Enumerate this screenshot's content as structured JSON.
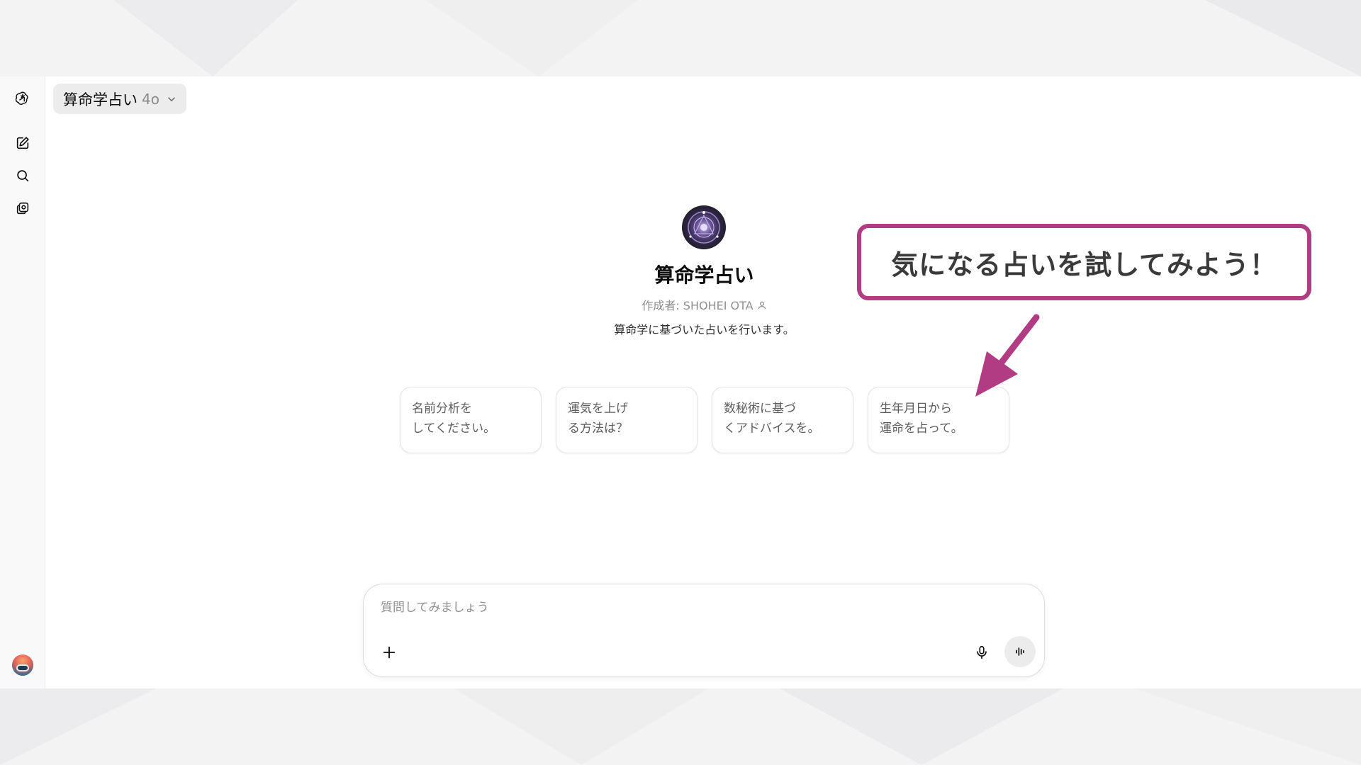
{
  "header": {
    "model_name": "算命学占い",
    "model_version": "4o"
  },
  "gpt": {
    "title": "算命学占い",
    "author": "作成者: SHOHEI OTA",
    "description": "算命学に基づいた占いを行います。"
  },
  "starters": [
    {
      "label": "名前分析を\nしてください。"
    },
    {
      "label": "運気を上げ\nる方法は？"
    },
    {
      "label": "数秘術に基づ\nくアドバイスを。"
    },
    {
      "label": "生年月日から\n運命を占って。"
    }
  ],
  "composer": {
    "placeholder": "質問してみましょう",
    "value": ""
  },
  "annotation": {
    "callout_text": "気になる占いを試してみよう！",
    "color": "#b13c84"
  },
  "icons": {
    "logo": "openai-logo-icon",
    "new_chat": "edit-icon",
    "search": "search-icon",
    "gpts": "gpts-icon",
    "attach": "plus-icon",
    "mic": "mic-icon",
    "voice": "voice-mode-icon"
  }
}
